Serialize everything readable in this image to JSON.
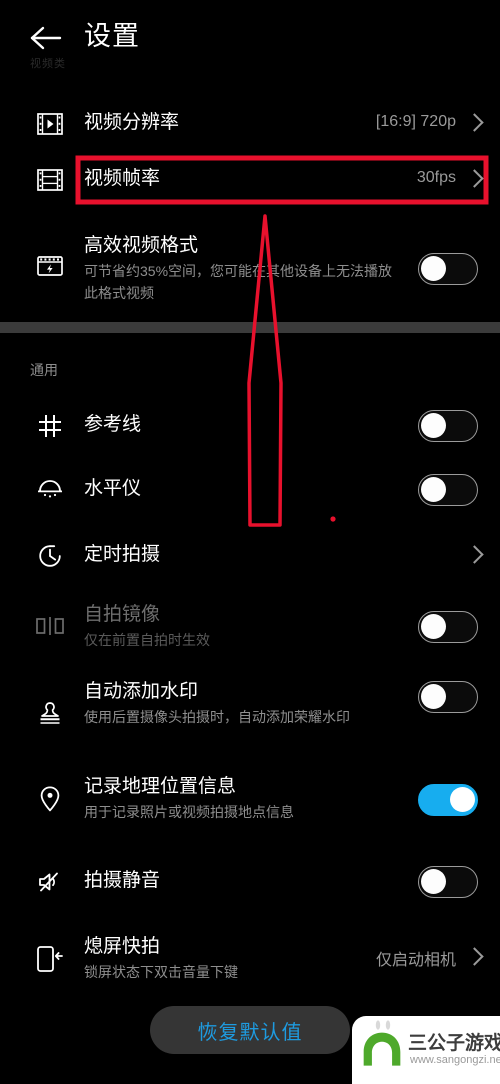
{
  "header": {
    "back_icon": "back-arrow-icon",
    "title": "设置",
    "faint_section_label": "视频类"
  },
  "sections": [
    {
      "id": "video",
      "group_title": "",
      "rows": [
        {
          "id": "video-resolution",
          "icon": "film-play-icon",
          "label": "视频分辨率",
          "sub": "",
          "value": "[16:9] 720p",
          "control": "chevron",
          "dim": false
        },
        {
          "id": "video-framerate",
          "icon": "film-strip-icon",
          "label": "视频帧率",
          "sub": "",
          "value": "30fps",
          "control": "chevron",
          "dim": false,
          "highlighted": true
        },
        {
          "id": "efficient-video-format",
          "icon": "video-lightning-icon",
          "label": "高效视频格式",
          "sub": "可节省约35%空间，您可能在其他设备上无法播放此格式视频",
          "value": "",
          "control": "toggle-off",
          "dim": false
        }
      ]
    },
    {
      "id": "general",
      "group_title": "通用",
      "rows": [
        {
          "id": "grid-lines",
          "icon": "grid-icon",
          "label": "参考线",
          "sub": "",
          "value": "",
          "control": "toggle-off",
          "dim": false
        },
        {
          "id": "level-meter",
          "icon": "level-dome-icon",
          "label": "水平仪",
          "sub": "",
          "value": "",
          "control": "toggle-off",
          "dim": false
        },
        {
          "id": "timer-capture",
          "icon": "timer-clock-icon",
          "label": "定时拍摄",
          "sub": "",
          "value": "",
          "control": "chevron",
          "dim": false
        },
        {
          "id": "selfie-mirror",
          "icon": "mirror-icon",
          "label": "自拍镜像",
          "sub": "仅在前置自拍时生效",
          "value": "",
          "control": "toggle-off",
          "dim": true
        },
        {
          "id": "auto-watermark",
          "icon": "stamp-icon",
          "label": "自动添加水印",
          "sub": "使用后置摄像头拍摄时，自动添加荣耀水印",
          "value": "",
          "control": "toggle-off",
          "dim": false
        },
        {
          "id": "geo-location",
          "icon": "location-pin-icon",
          "label": "记录地理位置信息",
          "sub": "用于记录照片或视频拍摄地点信息",
          "value": "",
          "control": "toggle-on",
          "dim": false
        },
        {
          "id": "shutter-mute",
          "icon": "mute-speaker-icon",
          "label": "拍摄静音",
          "sub": "",
          "value": "",
          "control": "toggle-off",
          "dim": false
        },
        {
          "id": "quick-snap",
          "icon": "phone-arrow-icon",
          "label": "熄屏快拍",
          "sub": "锁屏状态下双击音量下键",
          "value": "仅启动相机",
          "control": "chevron",
          "dim": false
        }
      ]
    }
  ],
  "reset_button": {
    "label": "恢复默认值"
  },
  "annotation": {
    "highlight_color": "#E8112D",
    "arrow_color": "#E8112D",
    "arrow_name": "pointing-arrow-annotation",
    "highlight_target": "视频帧率"
  },
  "watermark": {
    "title": "三公子游戏网",
    "url": "www.sangongzi.net",
    "logo_color": "#4EA92B"
  },
  "colors": {
    "background": "#000000",
    "toggle_on": "#17ADEF",
    "accent_text": "#1E9BE0",
    "secondary_text": "#8e8e8e",
    "band": "#3b3b3b"
  }
}
